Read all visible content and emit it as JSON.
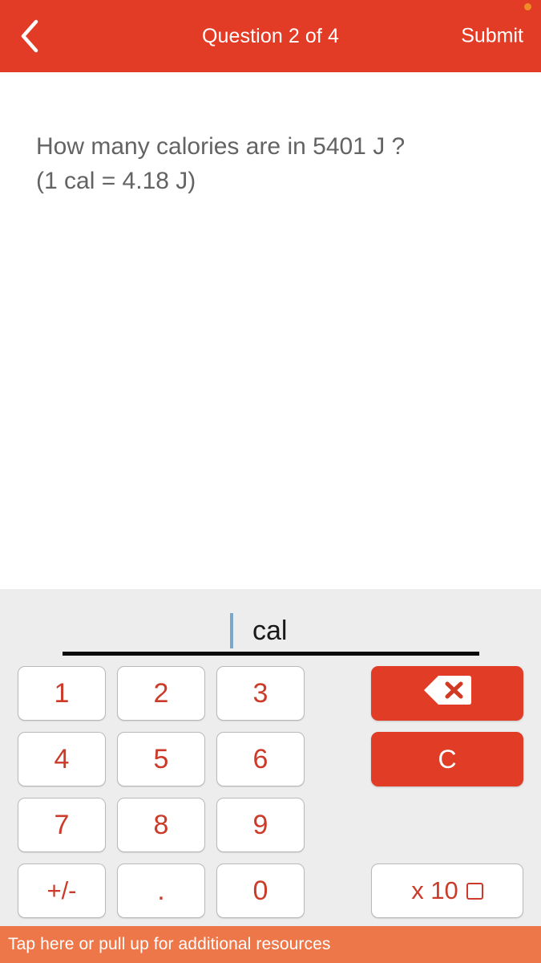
{
  "header": {
    "back_icon": "chevron-left-icon",
    "title": "Question 2 of 4",
    "submit_label": "Submit",
    "background_color": "#e33c26",
    "text_color": "#ffffff",
    "status_dot_color": "#f08c28"
  },
  "question": {
    "line1": "How many calories are in 5401 J ?",
    "line2": "(1 cal = 4.18 J)",
    "text_color": "#636363"
  },
  "answer": {
    "value": "",
    "caret_color": "#7ba7ca",
    "unit": "cal",
    "unit_color": "#1a1a1a",
    "rule_color": "#0b0b0b"
  },
  "keypad": {
    "background_color": "#ededed",
    "digit_color": "#cc3b29",
    "digits": [
      {
        "name": "key-1",
        "label": "1"
      },
      {
        "name": "key-2",
        "label": "2"
      },
      {
        "name": "key-3",
        "label": "3"
      },
      {
        "name": "key-4",
        "label": "4"
      },
      {
        "name": "key-5",
        "label": "5"
      },
      {
        "name": "key-6",
        "label": "6"
      },
      {
        "name": "key-7",
        "label": "7"
      },
      {
        "name": "key-8",
        "label": "8"
      },
      {
        "name": "key-9",
        "label": "9"
      },
      {
        "name": "key-plus-minus",
        "label": "+/-"
      },
      {
        "name": "key-decimal-point",
        "label": "."
      },
      {
        "name": "key-0",
        "label": "0"
      }
    ],
    "actions": {
      "backspace_icon": "backspace-delete-icon",
      "clear_label": "C",
      "exponent_label": "x 10",
      "exponent_placeholder_icon": "empty-square-icon",
      "red_button_color": "#e03c26"
    }
  },
  "bottom_bar": {
    "text": "Tap here or pull up for additional resources",
    "background_color": "#ee7749",
    "text_color": "#ffffff"
  }
}
